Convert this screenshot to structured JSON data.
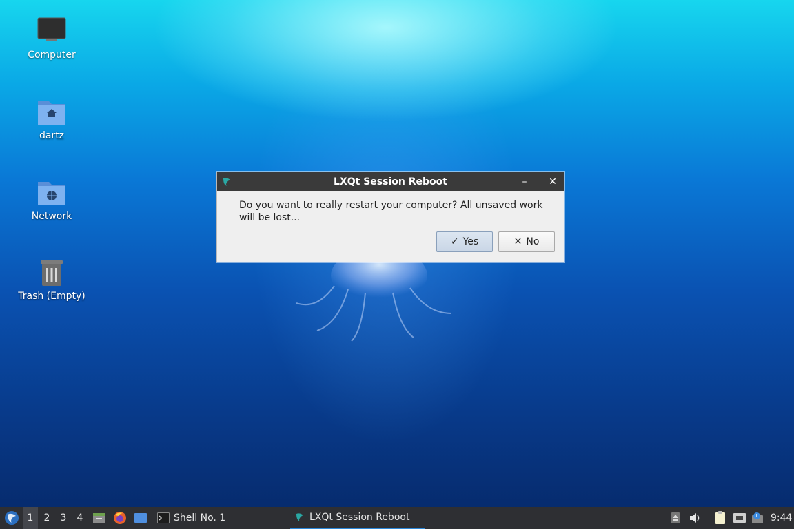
{
  "desktop": {
    "icons": [
      {
        "label": "Computer"
      },
      {
        "label": "dartz"
      },
      {
        "label": "Network"
      },
      {
        "label": "Trash (Empty)"
      }
    ]
  },
  "dialog": {
    "title": "LXQt Session Reboot",
    "message": "Do you want to really restart your computer? All unsaved work will be lost...",
    "yes_label": "Yes",
    "no_label": "No",
    "minimize_glyph": "–",
    "close_glyph": "✕",
    "yes_glyph": "✓",
    "no_glyph": "✕"
  },
  "taskbar": {
    "desktops": [
      "1",
      "2",
      "3",
      "4"
    ],
    "active_desktop": "1",
    "tasks": [
      {
        "label": "Shell No. 1",
        "icon": "terminal-icon"
      },
      {
        "label": "LXQt Session Reboot",
        "icon": "lxqt-icon"
      }
    ],
    "clock": "9:44",
    "accent": "#2b86d8"
  }
}
